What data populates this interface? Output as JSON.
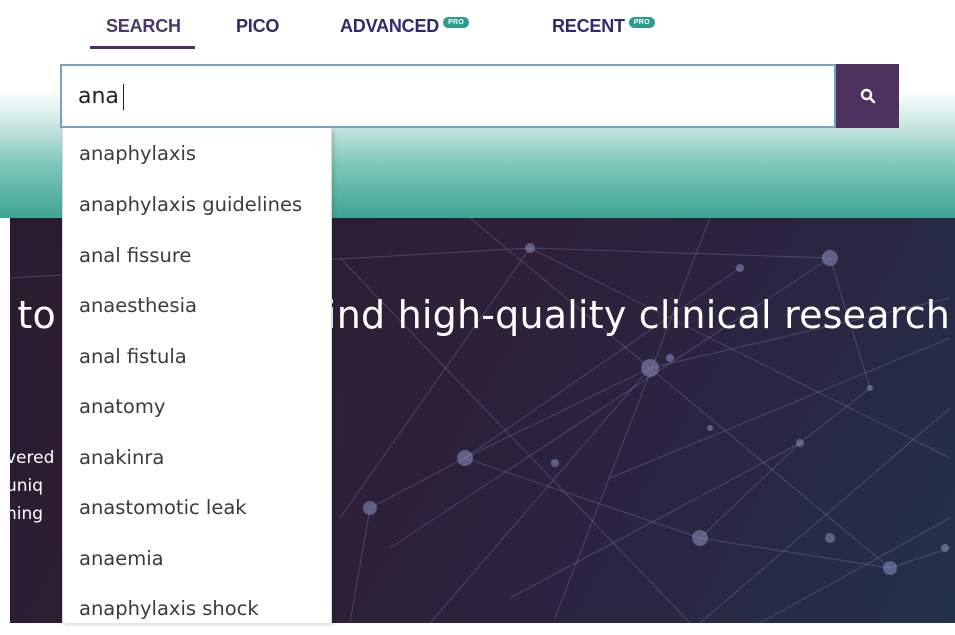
{
  "tabs": [
    {
      "label": "SEARCH",
      "active": true
    },
    {
      "label": "PICO",
      "active": false
    },
    {
      "label": "ADVANCED",
      "badge": "PRO",
      "active": false
    },
    {
      "label": "RECENT",
      "badge": "PRO",
      "active": false
    }
  ],
  "search": {
    "value": "ana",
    "button_icon": "search-icon"
  },
  "suggestions": [
    "anaphylaxis",
    "anaphylaxis guidelines",
    "anal fissure",
    "anaesthesia",
    "anal fistula",
    "anatomy",
    "anakinra",
    "anastomotic leak",
    "anaemia",
    "anaphylaxis shock"
  ],
  "hero": {
    "title_left": "t to",
    "title_right": "ind high-quality clinical research",
    "side_lines": [
      "vered",
      "uniq",
      "ning"
    ]
  },
  "colors": {
    "tab_text": "#2d2a6e",
    "active_underline": "#4d2e5f",
    "pro_badge": "#2a9d8f",
    "search_button": "#4f3160",
    "teal": "#3ea493"
  }
}
